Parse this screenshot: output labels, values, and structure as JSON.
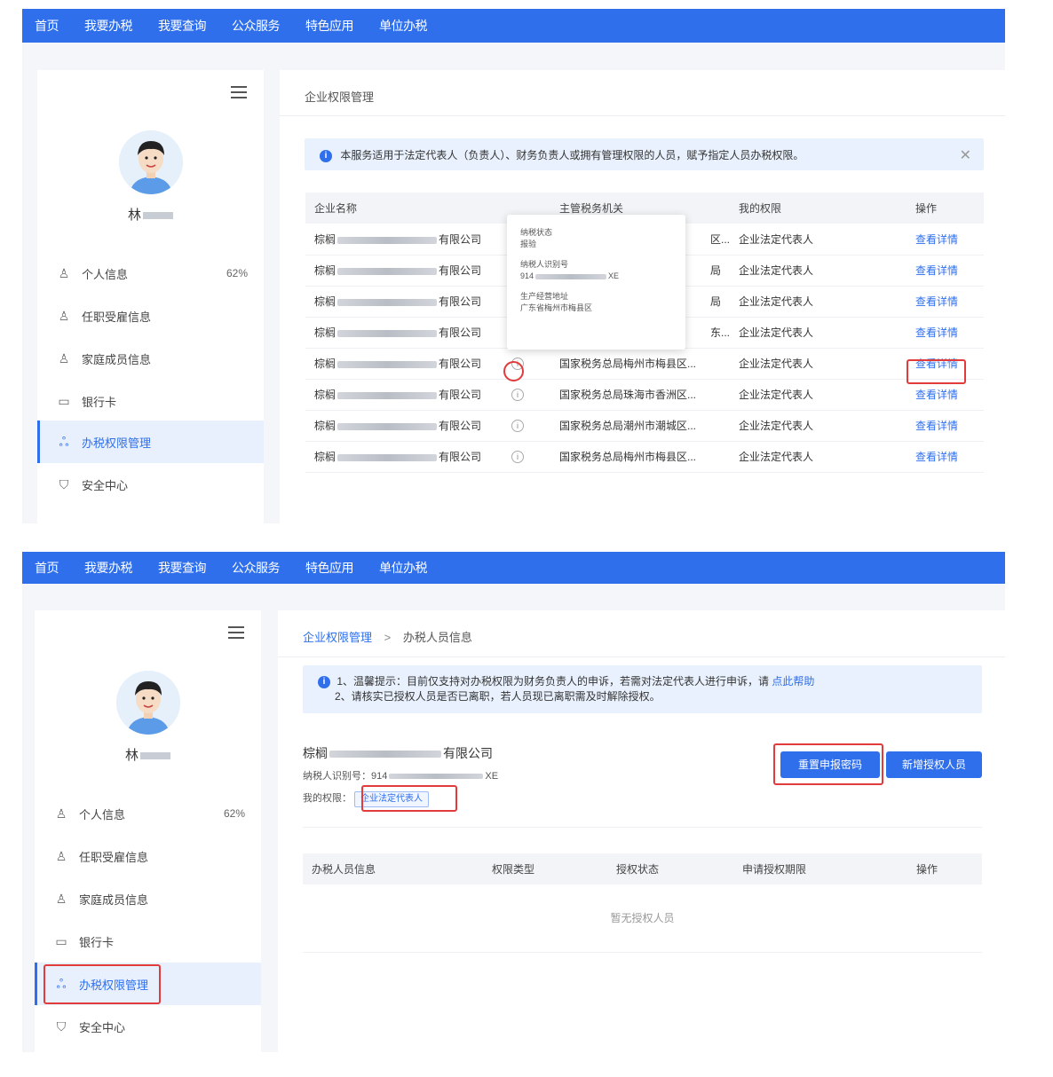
{
  "nav": [
    "首页",
    "我要办税",
    "我要查询",
    "公众服务",
    "特色应用",
    "单位办税"
  ],
  "user": {
    "name": "林"
  },
  "sidebar": {
    "items": [
      {
        "label": "个人信息",
        "icon": "user-icon",
        "pct": "62%"
      },
      {
        "label": "任职受雇信息",
        "icon": "user-check-icon"
      },
      {
        "label": "家庭成员信息",
        "icon": "family-icon"
      },
      {
        "label": "银行卡",
        "icon": "card-icon"
      },
      {
        "label": "办税权限管理",
        "icon": "org-icon",
        "active": true
      },
      {
        "label": "安全中心",
        "icon": "shield-icon"
      }
    ]
  },
  "screen1": {
    "breadcrumb": "企业权限管理",
    "notice": "本服务适用于法定代表人（负责人）、财务负责人或拥有管理权限的人员，赋予指定人员办税权限。",
    "table": {
      "headers": [
        "企业名称",
        "主管税务机关",
        "我的权限",
        "操作"
      ],
      "rows": [
        {
          "prefix": "棕榈",
          "suffix": "有限公司",
          "authority": "区...",
          "role": "企业法定代表人",
          "action": "查看详情"
        },
        {
          "prefix": "棕榈",
          "suffix": "有限公司",
          "authority": "局",
          "role": "企业法定代表人",
          "action": "查看详情"
        },
        {
          "prefix": "棕榈",
          "suffix": "有限公司",
          "authority": "局",
          "role": "企业法定代表人",
          "action": "查看详情"
        },
        {
          "prefix": "棕榈",
          "suffix": "有限公司",
          "authority": "东...",
          "role": "企业法定代表人",
          "action": "查看详情"
        },
        {
          "prefix": "棕榈",
          "suffix": "有限公司",
          "authority": "国家税务总局梅州市梅县区...",
          "role": "企业法定代表人",
          "action": "查看详情"
        },
        {
          "prefix": "棕榈",
          "suffix": "有限公司",
          "authority": "国家税务总局珠海市香洲区...",
          "role": "企业法定代表人",
          "action": "查看详情"
        },
        {
          "prefix": "棕榈",
          "suffix": "有限公司",
          "authority": "国家税务总局潮州市潮城区...",
          "role": "企业法定代表人",
          "action": "查看详情"
        },
        {
          "prefix": "棕榈",
          "suffix": "有限公司",
          "authority": "国家税务总局梅州市梅县区...",
          "role": "企业法定代表人",
          "action": "查看详情"
        }
      ]
    },
    "popup": {
      "status_label": "纳税状态",
      "status_value": "报验",
      "taxid_label": "纳税人识别号",
      "taxid_prefix": "914",
      "taxid_suffix": "XE",
      "address_label": "生产经营地址",
      "address_value": "广东省梅州市梅县区"
    }
  },
  "screen2": {
    "breadcrumb_parent": "企业权限管理",
    "breadcrumb_current": "办税人员信息",
    "notice_line1": "1、温馨提示：目前仅支持对办税权限为财务负责人的申诉，若需对法定代表人进行申诉，请",
    "notice_link": "点此帮助",
    "notice_line2": "2、请核实已授权人员是否已离职，若人员现已离职需及时解除授权。",
    "company_prefix": "棕榈",
    "company_suffix": "有限公司",
    "taxid_label": "纳税人识别号：914",
    "taxid_suffix": "XE",
    "perm_label": "我的权限：",
    "perm_tag": "企业法定代表人",
    "btn_reset": "重置申报密码",
    "btn_add": "新增授权人员",
    "table_headers": [
      "办税人员信息",
      "权限类型",
      "授权状态",
      "申请授权期限",
      "操作"
    ],
    "empty_text": "暂无授权人员"
  }
}
